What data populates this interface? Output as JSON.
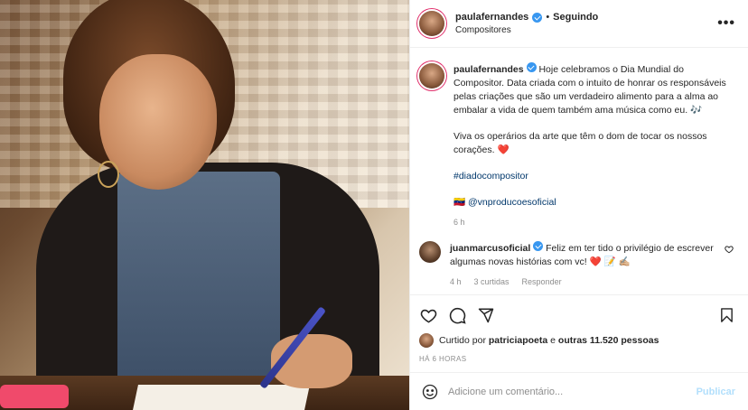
{
  "post": {
    "author": "paulafernandes",
    "follow_status": "Seguindo",
    "separator": "•",
    "location": "Compositores",
    "more_label": "•••",
    "caption": {
      "paragraph1": "Hoje celebramos o Dia Mundial do Compositor. Data criada com o intuito de honrar os responsáveis pelas criações que são um verdadeiro alimento para a alma ao embalar a vida de quem também ama música como eu. 🎶",
      "paragraph2": "Viva os operários da arte que têm o dom de tocar os nossos corações. ❤️",
      "hashtag": "#diadocompositor",
      "mention_flag": "🇻🇪",
      "mention": "@vnproducoesoficial"
    },
    "caption_time": "6 h"
  },
  "comment": {
    "author": "juanmarcusoficial",
    "text": "Feliz em ter tido o privilégio de escrever algumas novas histórias com vc! ❤️ 📝 ✍🏼",
    "time": "4 h",
    "likes": "3 curtidas",
    "reply": "Responder"
  },
  "engagement": {
    "liked_prefix": "Curtido por",
    "liked_user": "patriciapoeta",
    "liked_conj": "e",
    "liked_others": "outras 11.520 pessoas",
    "posted_ago": "HÁ 6 HORAS"
  },
  "composer": {
    "placeholder": "Adicione um comentário...",
    "publish_label": "Publicar"
  },
  "colors": {
    "verified": "#3897f0",
    "heart": "#ed4956",
    "publish_disabled": "#b2dffc",
    "link": "#00376b"
  },
  "icons": [
    "heart-icon",
    "comment-icon",
    "share-icon",
    "bookmark-icon",
    "emoji-icon",
    "verified-icon",
    "more-icon"
  ]
}
